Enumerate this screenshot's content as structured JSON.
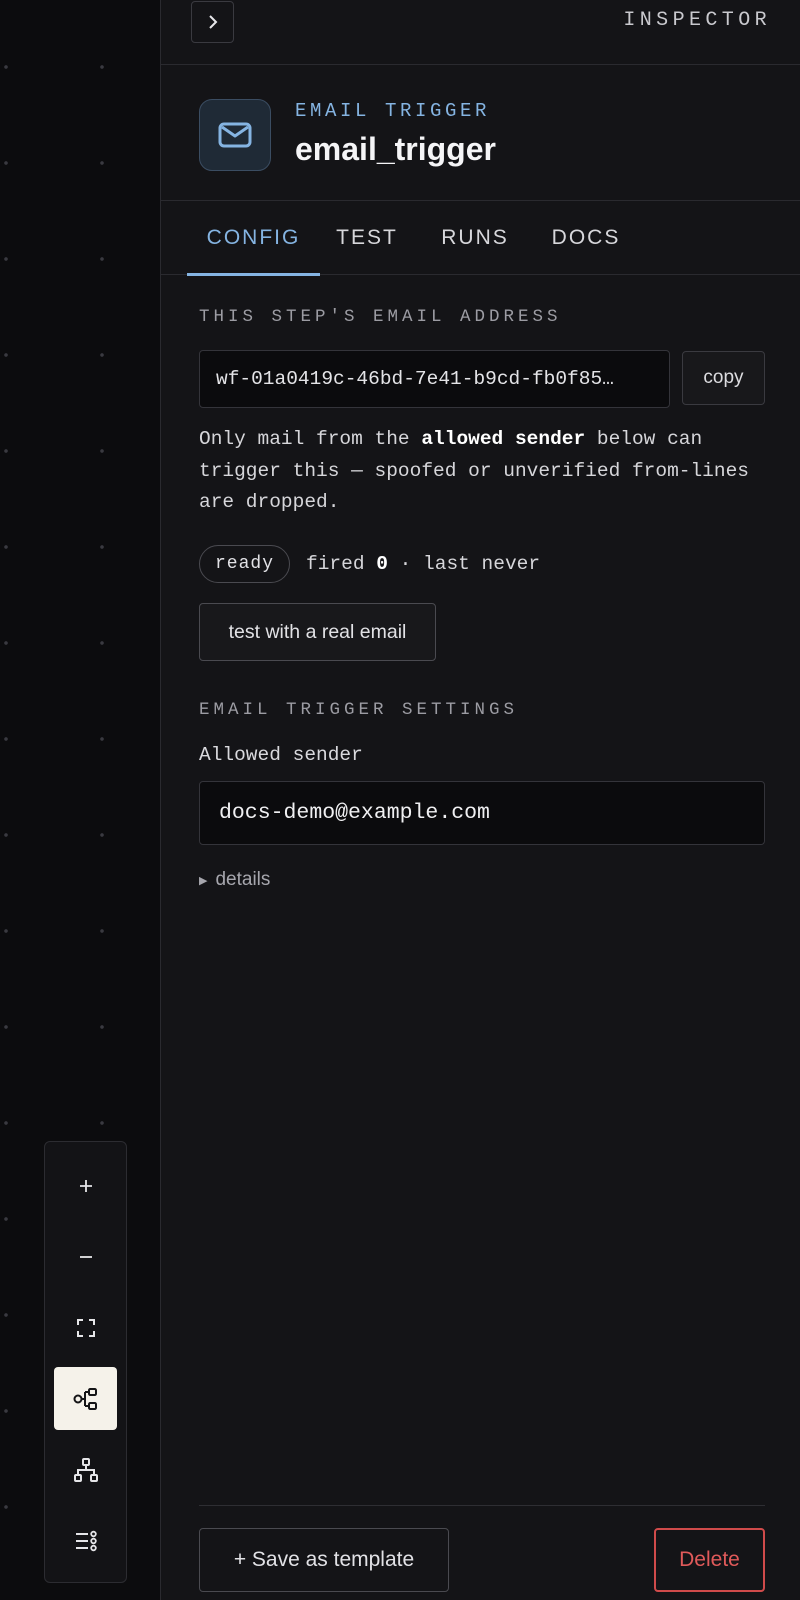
{
  "inspector": {
    "title": "INSPECTOR",
    "collapse_icon": "chevron-right-icon"
  },
  "node": {
    "kind": "EMAIL TRIGGER",
    "name": "email_trigger",
    "icon": "mail-icon",
    "accent_color": "#85b4e2"
  },
  "tabs": [
    {
      "label": "CONFIG",
      "active": true
    },
    {
      "label": "TEST",
      "active": false
    },
    {
      "label": "RUNS",
      "active": false
    },
    {
      "label": "DOCS",
      "active": false
    }
  ],
  "address_section": {
    "label": "THIS STEP'S EMAIL ADDRESS",
    "address": "wf-01a0419c-46bd-7e41-b9cd-fb0f85…",
    "copy_label": "copy",
    "help_prefix": "Only mail from the ",
    "help_emphasis": "allowed sender",
    "help_suffix": " below can trigger this — spoofed or unverified from-lines are dropped."
  },
  "status": {
    "badge": "ready",
    "fired_prefix": "fired ",
    "fired_count": "0",
    "last_text": " · last never"
  },
  "test_button": "test with a real email",
  "settings": {
    "label": "EMAIL TRIGGER SETTINGS",
    "allowed_sender_label": "Allowed sender",
    "allowed_sender_value": "docs-demo@example.com",
    "details_label": "details"
  },
  "footer": {
    "save_label": "+ Save as template",
    "delete_label": "Delete",
    "delete_color": "#e05a5a"
  },
  "canvas_controls": [
    {
      "icon": "zoom-in-icon",
      "active": false
    },
    {
      "icon": "zoom-out-icon",
      "active": false
    },
    {
      "icon": "fit-view-icon",
      "active": false
    },
    {
      "icon": "horizontal-layout-icon",
      "active": true
    },
    {
      "icon": "tree-layout-icon",
      "active": false
    },
    {
      "icon": "list-layout-icon",
      "active": false
    }
  ]
}
